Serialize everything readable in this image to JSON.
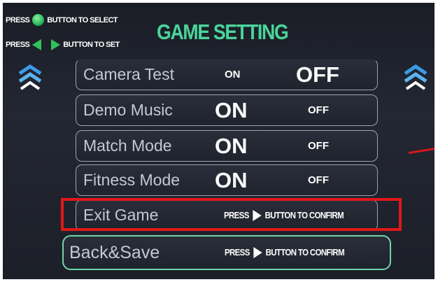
{
  "hints": {
    "select": {
      "press": "PRESS",
      "suffix": "BUTTON TO SELECT"
    },
    "set": {
      "press": "PRESS",
      "suffix": "BUTTON TO SET"
    }
  },
  "title": "GAME SETTING",
  "settings": [
    {
      "label": "Camera Test",
      "on": "ON",
      "off": "OFF",
      "selected": "off"
    },
    {
      "label": "Demo Music",
      "on": "ON",
      "off": "OFF",
      "selected": "on"
    },
    {
      "label": "Match Mode",
      "on": "ON",
      "off": "OFF",
      "selected": "on"
    },
    {
      "label": "Fitness Mode",
      "on": "ON",
      "off": "OFF",
      "selected": "on"
    }
  ],
  "exit_game": {
    "label": "Exit Game",
    "press": "PRESS",
    "suffix": "BUTTON TO CONFIRM"
  },
  "back_save": {
    "label": "Back&Save",
    "press": "PRESS",
    "suffix": "BUTTON TO CONFIRM"
  },
  "colors": {
    "title": "#4ed29b",
    "accent_green": "#2fc25c",
    "highlight_red": "#e01818",
    "chevron_blue": "#3b9be8"
  },
  "icons": {
    "select_button": "green-circle-button",
    "left_arrow": "green-left-triangle",
    "right_arrow": "green-right-triangle",
    "scroll_up": "double-chevron-up-icon",
    "confirm_arrow": "white-right-triangle"
  }
}
